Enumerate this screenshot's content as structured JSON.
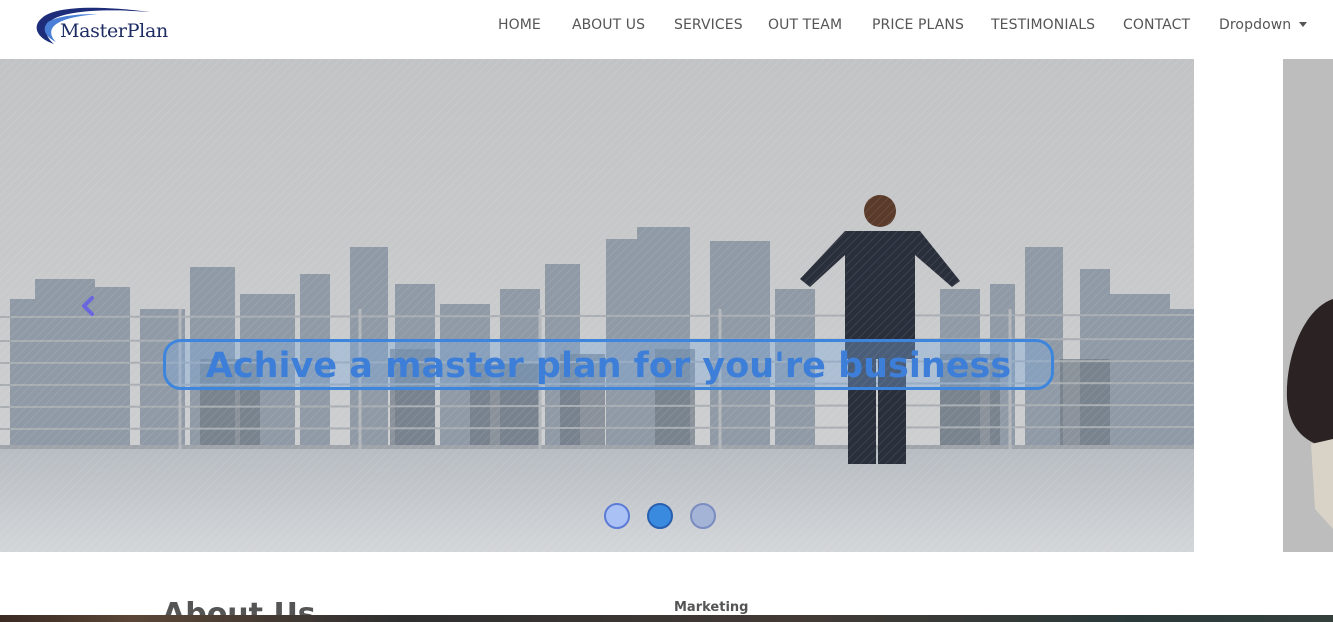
{
  "brand": {
    "name": "MasterPlan"
  },
  "nav": {
    "items": [
      "HOME",
      "ABOUT US",
      "SERVICES",
      "OUT TEAM",
      "PRICE PLANS",
      "TESTIMONIALS",
      "CONTACT"
    ],
    "dropdown_label": "Dropdown"
  },
  "carousel": {
    "caption": "Achive a master plan for you're business",
    "active_index": 1,
    "indicator_count": 3
  },
  "about": {
    "title": "About Us"
  },
  "side": {
    "label": "Marketing"
  },
  "colors": {
    "accent": "#3d7fd8",
    "arrow": "#6a66e0",
    "nav_text": "#555555"
  }
}
